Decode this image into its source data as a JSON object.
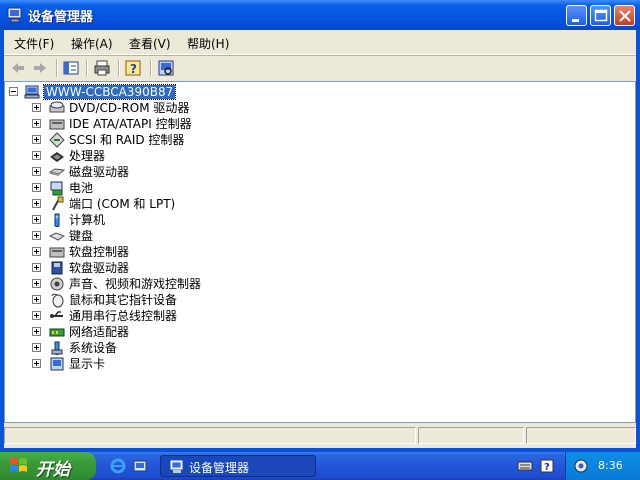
{
  "window": {
    "title": "设备管理器"
  },
  "menu": {
    "items": [
      {
        "label": "文件(F)"
      },
      {
        "label": "操作(A)"
      },
      {
        "label": "查看(V)"
      },
      {
        "label": "帮助(H)"
      }
    ]
  },
  "toolbar": {
    "icons": [
      "back-arrow-icon",
      "forward-arrow-icon",
      "properties-icon",
      "print-icon",
      "help-icon",
      "scan-hardware-icon"
    ]
  },
  "tree": {
    "root": "WWW-CCBCA390B87",
    "items": [
      {
        "label": "DVD/CD-ROM 驱动器",
        "icon": "cdrom-icon"
      },
      {
        "label": "IDE ATA/ATAPI 控制器",
        "icon": "ide-controller-icon"
      },
      {
        "label": "SCSI 和 RAID 控制器",
        "icon": "scsi-icon"
      },
      {
        "label": "处理器",
        "icon": "processor-icon"
      },
      {
        "label": "磁盘驱动器",
        "icon": "disk-drive-icon"
      },
      {
        "label": "电池",
        "icon": "battery-icon"
      },
      {
        "label": "端口 (COM 和 LPT)",
        "icon": "port-icon"
      },
      {
        "label": "计算机",
        "icon": "computer-icon"
      },
      {
        "label": "键盘",
        "icon": "keyboard-icon"
      },
      {
        "label": "软盘控制器",
        "icon": "floppy-controller-icon"
      },
      {
        "label": "软盘驱动器",
        "icon": "floppy-drive-icon"
      },
      {
        "label": "声音、视频和游戏控制器",
        "icon": "sound-icon"
      },
      {
        "label": "鼠标和其它指针设备",
        "icon": "mouse-icon"
      },
      {
        "label": "通用串行总线控制器",
        "icon": "usb-icon"
      },
      {
        "label": "网络适配器",
        "icon": "network-adapter-icon"
      },
      {
        "label": "系统设备",
        "icon": "system-device-icon"
      },
      {
        "label": "显示卡",
        "icon": "display-adapter-icon"
      }
    ]
  },
  "taskbar": {
    "start_label": "开始",
    "task_label": "设备管理器",
    "clock": "8:36"
  },
  "colors": {
    "titlebar": "#0653e0",
    "selection": "#316ac5",
    "start_green": "#3a9a3a"
  }
}
